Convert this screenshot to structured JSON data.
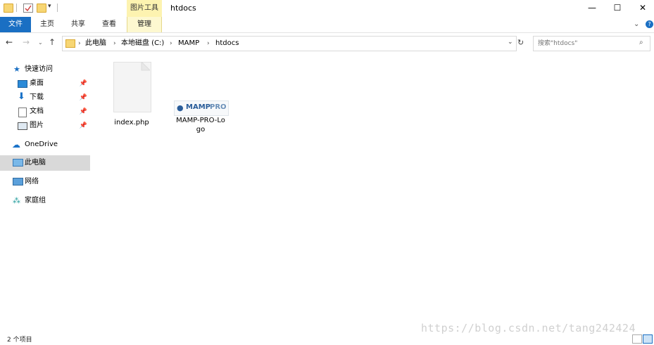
{
  "titlebar": {
    "tool_tab": "图片工具",
    "title": "htdocs",
    "minimize": "—",
    "maximize": "☐",
    "close": "✕"
  },
  "ribbon": {
    "tabs": [
      {
        "label": "文件"
      },
      {
        "label": "主页"
      },
      {
        "label": "共享"
      },
      {
        "label": "查看"
      },
      {
        "label": "管理"
      }
    ],
    "help": "?"
  },
  "address": {
    "crumbs": [
      "此电脑",
      "本地磁盘 (C:)",
      "MAMP",
      "htdocs"
    ],
    "search_placeholder": "搜索\"htdocs\""
  },
  "nav": {
    "quick_access": "快速访问",
    "items": [
      {
        "label": "桌面",
        "icon": "desktop-icon"
      },
      {
        "label": "下载",
        "icon": "download-icon"
      },
      {
        "label": "文档",
        "icon": "document-icon"
      },
      {
        "label": "图片",
        "icon": "pictures-icon"
      }
    ],
    "onedrive": "OneDrive",
    "this_pc": "此电脑",
    "network": "网络",
    "homegroup": "家庭组"
  },
  "files": [
    {
      "name": "index.php",
      "type": "file"
    },
    {
      "name": "MAMP-PRO-Lo\ngo",
      "type": "image",
      "logo_text_a": "MAMP",
      "logo_text_b": "PRO"
    }
  ],
  "status": {
    "count": "2 个项目"
  },
  "watermark": "https://blog.csdn.net/tang242424",
  "colors": {
    "file_tab": "#1a6fc3",
    "selection": "#d9d9d9",
    "tool_tab": "#fdf3b0"
  }
}
